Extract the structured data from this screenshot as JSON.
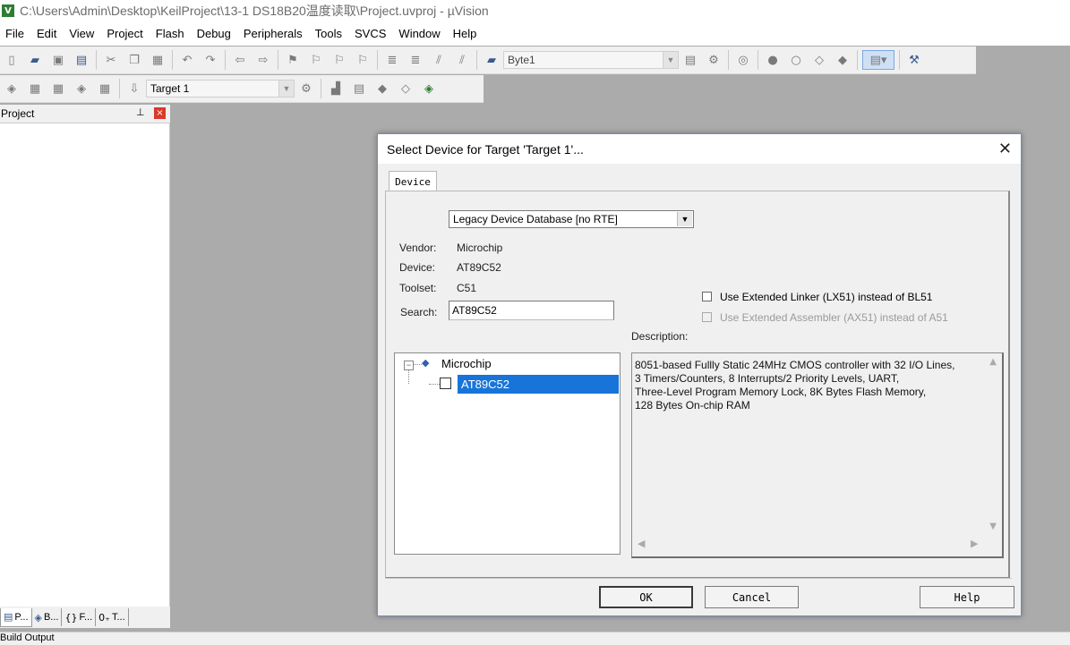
{
  "window": {
    "title": "C:\\Users\\Admin\\Desktop\\KeilProject\\13-1 DS18B20温度读取\\Project.uvproj - µVision",
    "icon": "app-icon"
  },
  "menu": [
    "File",
    "Edit",
    "View",
    "Project",
    "Flash",
    "Debug",
    "Peripherals",
    "Tools",
    "SVCS",
    "Window",
    "Help"
  ],
  "toolbar1": {
    "combo_value": "Byte1"
  },
  "toolbar2": {
    "target_value": "Target 1"
  },
  "project_panel": {
    "title": "Project",
    "tabs": [
      "P...",
      "B...",
      "F...",
      "T..."
    ]
  },
  "status": {
    "text": "Build Output"
  },
  "dialog": {
    "title": "Select Device for Target 'Target 1'...",
    "tab": "Device",
    "database": "Legacy Device Database [no RTE]",
    "vendor_label": "Vendor:",
    "vendor_value": "Microchip",
    "device_label": "Device:",
    "device_value": "AT89C52",
    "toolset_label": "Toolset:",
    "toolset_value": "C51",
    "search_label": "Search:",
    "search_value": "AT89C52",
    "option_linker": "Use Extended Linker (LX51) instead of BL51",
    "option_assembler": "Use Extended Assembler (AX51) instead of A51",
    "description_label": "Description:",
    "tree": {
      "vendor": "Microchip",
      "device": "AT89C52"
    },
    "description": "8051-based Fullly Static 24MHz CMOS controller with 32  I/O Lines,\n3 Timers/Counters, 8 Interrupts/2 Priority Levels, UART,\nThree-Level Program Memory Lock, 8K Bytes Flash Memory,\n128 Bytes On-chip RAM",
    "buttons": {
      "ok": "OK",
      "cancel": "Cancel",
      "help": "Help"
    }
  }
}
